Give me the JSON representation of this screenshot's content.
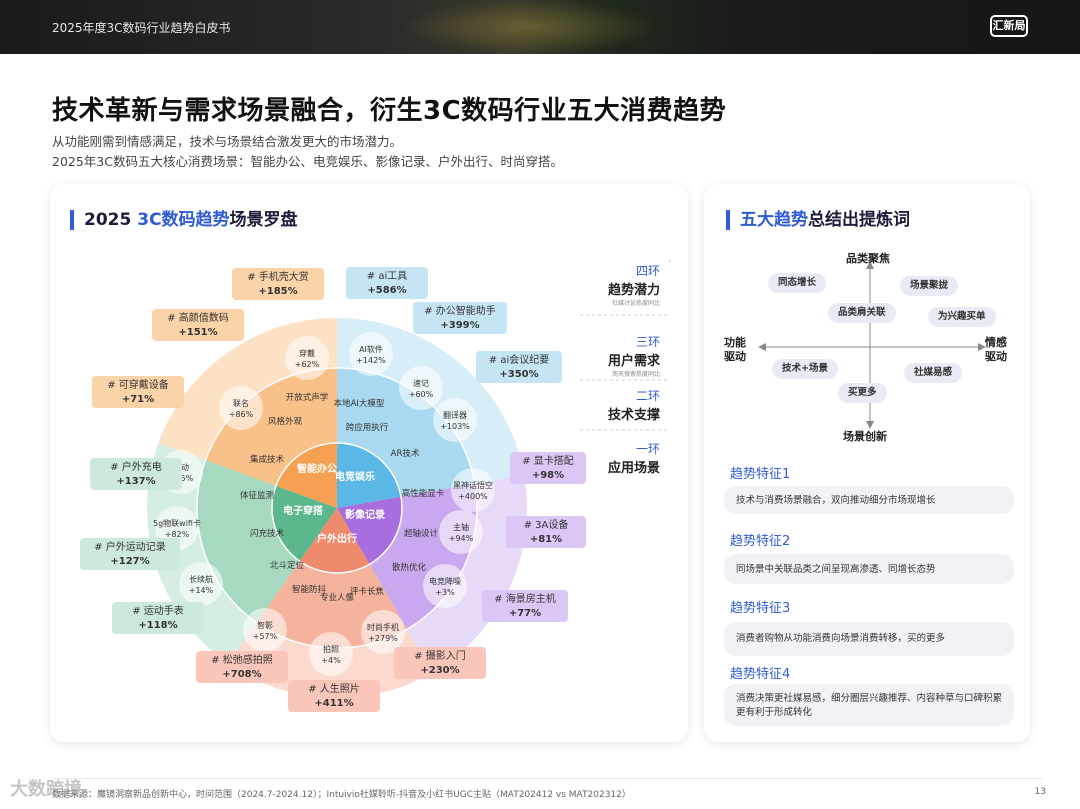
{
  "header": {
    "title": "2025年度3C数码行业趋势白皮书",
    "logo_text": "汇新局"
  },
  "page": {
    "title": "技术革新与需求场景融合，衍生3C数码行业五大消费趋势",
    "subtitle_1": "从功能刚需到情感满足，技术与场景结合激发更大的市场潜力。",
    "subtitle_2": "2025年3C数码五大核心消费场景：智能办公、电竞娱乐、影像记录、户外出行、时尚穿搭。"
  },
  "left_card": {
    "title_prefix": "2025 ",
    "title_highlight": "3C数码趋势",
    "title_suffix": "场景罗盘",
    "center": [
      "电子穿搭",
      "智能办公",
      "电竞娱乐",
      "影像记录",
      "户外出行"
    ],
    "ring2": [
      "开放式声学",
      "本地AI大模型",
      "风格外观",
      "跨应用执行",
      "集成技术",
      "AR技术",
      "体征监测",
      "高性能显卡",
      "闪充技术",
      "超轴设计",
      "北斗定位",
      "散热优化",
      "智能防抖",
      "专业人像",
      "评卡长焦"
    ],
    "ring3": [
      {
        "n": "穿戴",
        "v": "+62%"
      },
      {
        "n": "AI软件",
        "v": "+142%"
      },
      {
        "n": "联名",
        "v": "+86%"
      },
      {
        "n": "速记",
        "v": "+60%"
      },
      {
        "n": "翻译器",
        "v": "+103%"
      },
      {
        "n": "运动",
        "v": "+95%"
      },
      {
        "n": "黑神话悟空",
        "v": "+400%"
      },
      {
        "n": "5g物联wifi卡",
        "v": "+82%"
      },
      {
        "n": "主轴",
        "v": "+94%"
      },
      {
        "n": "长续航",
        "v": "+14%"
      },
      {
        "n": "电竞降噪",
        "v": "+3%"
      },
      {
        "n": "智影",
        "v": "+57%"
      },
      {
        "n": "拍照",
        "v": "+4%"
      },
      {
        "n": "时尚手机",
        "v": "+279%"
      }
    ],
    "tags": [
      {
        "name": "# 手机壳大赏",
        "pct": "+185%"
      },
      {
        "name": "# ai工具",
        "pct": "+586%"
      },
      {
        "name": "# 高颜值数码",
        "pct": "+151%"
      },
      {
        "name": "# 办公智能助手",
        "pct": "+399%"
      },
      {
        "name": "# 可穿戴设备",
        "pct": "+71%"
      },
      {
        "name": "# ai会议纪要",
        "pct": "+350%"
      },
      {
        "name": "# 户外充电",
        "pct": "+137%"
      },
      {
        "name": "# 显卡搭配",
        "pct": "+98%"
      },
      {
        "name": "# 3A设备",
        "pct": "+81%"
      },
      {
        "name": "# 户外运动记录",
        "pct": "+127%"
      },
      {
        "name": "# 海景房主机",
        "pct": "+77%"
      },
      {
        "name": "# 运动手表",
        "pct": "+118%"
      },
      {
        "name": "# 松弛感拍照",
        "pct": "+708%"
      },
      {
        "name": "# 摄影入门",
        "pct": "+230%"
      },
      {
        "name": "# 人生照片",
        "pct": "+411%"
      }
    ],
    "legend": [
      {
        "ring": "四环",
        "label": "趋势潜力",
        "note": "社媒讨论热度同比"
      },
      {
        "ring": "三环",
        "label": "用户需求",
        "note": "淘天搜索热度同比"
      },
      {
        "ring": "二环",
        "label": "技术支撑",
        "note": ""
      },
      {
        "ring": "一环",
        "label": "应用场景",
        "note": ""
      }
    ]
  },
  "right_card": {
    "title_highlight": "五大趋势",
    "title_suffix": "总结出提炼词",
    "axis": {
      "top": "品类聚焦",
      "bottom": "场景创新",
      "left": "功能\n驱动",
      "right": "情感\n驱动"
    },
    "pills": [
      "同态增长",
      "场景聚拢",
      "品类肩关联",
      "为兴趣买单",
      "技术+场景",
      "社媒易感",
      "买更多"
    ],
    "features": [
      {
        "title": "趋势特征1",
        "text": "技术与消费场景融合，双向推动细分市场现增长"
      },
      {
        "title": "趋势特征2",
        "text": "同场景中关联品类之间呈现高渗透、同增长态势"
      },
      {
        "title": "趋势特征3",
        "text": "消费者购物从功能消费向场景消费转移，买的更多"
      },
      {
        "title": "趋势特征4",
        "text": "消费决策更社媒易感，细分圈层兴趣推荐、内容种草与口碑积累更有利于形成转化"
      }
    ]
  },
  "footer": {
    "source": "数据来源：魔镜洞察新品创新中心，时间范围（2024.7-2024.12）；Intuivio社媒聆听-抖音及小红书UGC主贴（MAT202412 vs MAT202312）",
    "page": "13",
    "watermark": "大数跨境"
  },
  "colors": {
    "accent": "#2f5bd6",
    "orange": "#f5a052",
    "blue": "#5bb8e6",
    "purple": "#a86ee0",
    "salmon": "#ef8b6c",
    "green": "#5cb88c"
  }
}
